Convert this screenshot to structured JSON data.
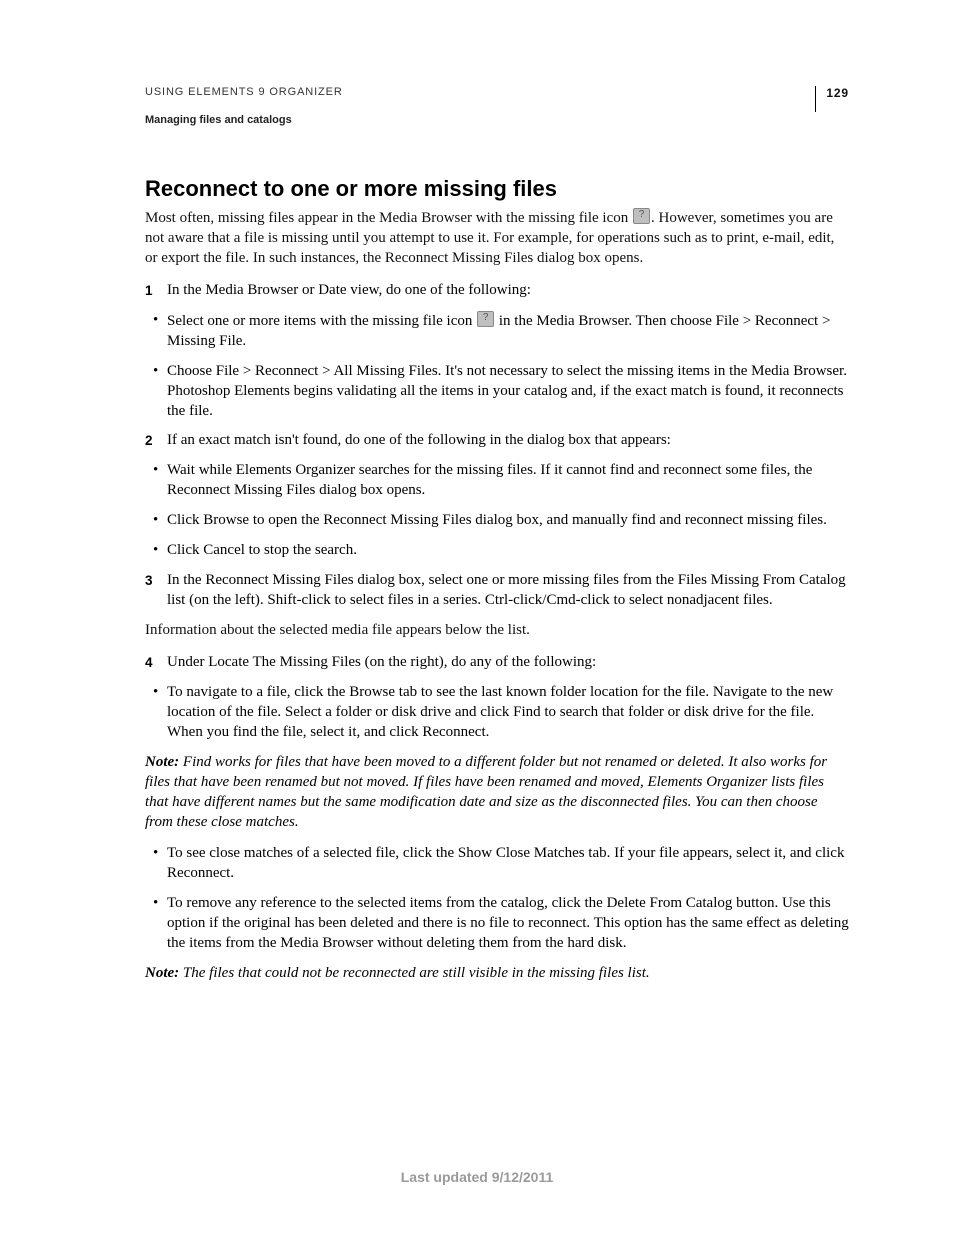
{
  "header": {
    "doc_title": "USING ELEMENTS 9 ORGANIZER",
    "section": "Managing files and catalogs",
    "page_number": "129"
  },
  "article": {
    "title": "Reconnect to one or more missing files",
    "intro_a": "Most often, missing files appear in the Media Browser with the missing file icon ",
    "intro_b": ". However, sometimes you are not aware that a file is missing until you attempt to use it. For example, for operations such as to print, e-mail, edit, or export the file. In such instances, the Reconnect Missing Files dialog box opens.",
    "step1": "In the Media Browser or Date view, do one of the following:",
    "step1_b1_a": "Select one or more items with the missing file icon ",
    "step1_b1_b": " in the Media Browser. Then choose File > Reconnect > Missing File.",
    "step1_b2": "Choose File > Reconnect > All Missing Files. It's not necessary to select the missing items in the Media Browser. Photoshop Elements begins validating all the items in your catalog and, if the exact match is found, it reconnects the file.",
    "step2": "If an exact match isn't found, do one of the following in the dialog box that appears:",
    "step2_b1": "Wait while Elements Organizer searches for the missing files. If it cannot find and reconnect some files, the Reconnect Missing Files dialog box opens.",
    "step2_b2": "Click Browse to open the Reconnect Missing Files dialog box, and manually find and reconnect missing files.",
    "step2_b3": "Click Cancel to stop the search.",
    "step3": "In the Reconnect Missing Files dialog box, select one or more missing files from the Files Missing From Catalog list (on the left). Shift-click to select files in a series. Ctrl-click/Cmd-click to select nonadjacent files.",
    "after3": "Information about the selected media file appears below the list.",
    "step4": "Under Locate The Missing Files (on the right), do any of the following:",
    "step4_b1": "To navigate to a file, click the Browse tab to see the last known folder location for the file. Navigate to the new location of the file. Select a folder or disk drive and click Find to search that folder or disk drive for the file. When you find the file, select it, and click Reconnect.",
    "note1_label": "Note:",
    "note1_text": " Find works for files that have been moved to a different folder but not renamed or deleted. It also works for files that have been renamed but not moved. If files have been renamed and moved, Elements Organizer lists files that have different names but the same modification date and size as the disconnected files. You can then choose from these close matches.",
    "step4_b2": "To see close matches of a selected file, click the Show Close Matches tab. If your file appears, select it, and click Reconnect.",
    "step4_b3": "To remove any reference to the selected items from the catalog, click the Delete From Catalog button. Use this option if the original has been deleted and there is no file to reconnect. This option has the same effect as deleting the items from the Media Browser without deleting them from the hard disk.",
    "note2_label": "Note:",
    "note2_text": " The files that could not be reconnected are still visible in the missing files list."
  },
  "footer": {
    "updated": "Last updated 9/12/2011"
  }
}
